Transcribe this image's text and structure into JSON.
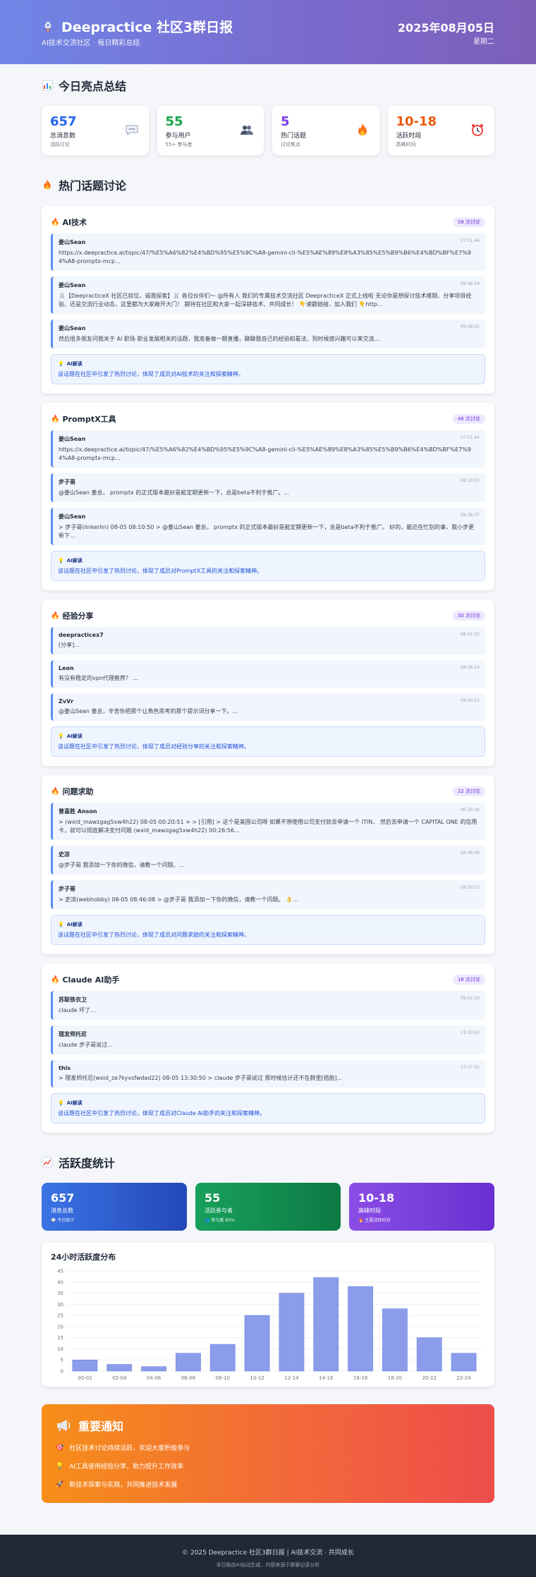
{
  "header": {
    "title": "Deepractice 社区3群日报",
    "subtitle": "AI技术交流社区 · 每日精彩总结",
    "date": "2025年08月05日",
    "weekday": "星期二"
  },
  "summary": {
    "title": "今日亮点总结",
    "cards": [
      {
        "value": "657",
        "label": "总消息数",
        "sub": "活跃讨论",
        "color": "#2563eb",
        "icon": "speech-bubble-icon"
      },
      {
        "value": "55",
        "label": "参与用户",
        "sub": "55+ 参与者",
        "color": "#16a34a",
        "icon": "users-icon"
      },
      {
        "value": "5",
        "label": "热门话题",
        "sub": "讨论焦点",
        "color": "#7c3aed",
        "icon": "fire-icon"
      },
      {
        "value": "10-18",
        "label": "活跃时段",
        "sub": "高峰时间",
        "color": "#ea580c",
        "icon": "alarm-clock-icon"
      }
    ]
  },
  "topics": {
    "title": "热门话题讨论",
    "ai_label": "AI解读",
    "items": [
      {
        "name": "AI技术",
        "badge": "58 次讨论",
        "messages": [
          {
            "author": "姜山Sean",
            "time": "07:51:44",
            "text": "https://x.deepractice.ai/topic/47/%E5%A6%82%E4%BD%95%E5%9C%A8-gemini-cli-%E5%AE%89%E8%A3%85%E5%B9%B6%E4%BD%BF%E7%94%A8-promptx-mcp..."
          },
          {
            "author": "姜山Sean",
            "time": "09:46:59",
            "text": "🐰【DeepracticeX 社区已就位，诚邀探索】🐰 各位伙伴们～ @所有人 我们的专属技术交流社区 DeepracticeX 正式上线啦 无论你是想探讨技术难题、分享项目经验、还是交流行业动态，这里都为大家敞开大门！ 期待在社区和大家一起深耕技术、共同成长！ 👇速戳链接，加入我们 👇http..."
          },
          {
            "author": "姜山Sean",
            "time": "09:58:01",
            "text": "然后很多朋友问我关于 AI 职场 职业发展相关的话题，我准备做一期直播，聊聊我自己的经验和看法，到时候感兴趣可以来交流..."
          }
        ],
        "ai": "该话题在社区中引发了热烈讨论，体现了成员对AI技术的关注和探索精神。"
      },
      {
        "name": "PromptX工具",
        "badge": "46 次讨论",
        "messages": [
          {
            "author": "姜山Sean",
            "time": "07:51:44",
            "text": "https://x.deepractice.ai/topic/47/%E5%A6%82%E4%BD%95%E5%9C%A8-gemini-cli-%E5%AE%89%E8%A3%85%E5%B9%B6%E4%BD%BF%E7%94%A8-promptx-mcp..."
          },
          {
            "author": "步子哥",
            "time": "08:10:50",
            "text": "@姜山Sean 姜总， promptx 的正式版本最好是能定期更新一下，总是beta不利于推广。..."
          },
          {
            "author": "姜山Sean",
            "time": "09:36:37",
            "text": "> 步子哥(linkerlin) 08-05 08:10:50 > @姜山Sean 姜总， promptx 的正式版本最好是能定期更新一下，总是beta不利于推广。 好的，最近在忙别的事，我小步更新下..."
          }
        ],
        "ai": "该话题在社区中引发了热烈讨论，体现了成员对PromptX工具的关注和探索精神。"
      },
      {
        "name": "经验分享",
        "badge": "30 次讨论",
        "messages": [
          {
            "author": "deepracticex7",
            "time": "08:01:25",
            "text": "[分享]..."
          },
          {
            "author": "Leon",
            "time": "09:26:24",
            "text": "有没有稳定的vpn代理推荐？ ..."
          },
          {
            "author": "ZvVr",
            "time": "09:43:23",
            "text": "@姜山Sean 姜总，辛苦你把那个让角色思考的那个提示词分享一下。..."
          }
        ],
        "ai": "该话题在社区中引发了热烈讨论，体现了成员对经验分享的关注和探索精神。"
      },
      {
        "name": "问题求助",
        "badge": "22 次讨论",
        "messages": [
          {
            "author": "曾喜胜 Anson",
            "time": "00:20:34",
            "text": "> (wxid_mawzgag5xw4h22) 08-05 00:20:51 > > [引用] > 这个是美国公司呀 如果不想使用公司支付就去申请一个 ITIN， 然后去申请一个 CAPITAL ONE 的信用卡，就可以彻底解决支付问题 (wxid_mawzgag5xw4h22) 00:26:56..."
          },
          {
            "author": "史凉",
            "time": "08:46:08",
            "text": "@步子哥 我添加一下你的微信，请教一个问题。..."
          },
          {
            "author": "步子哥",
            "time": "08:50:53",
            "text": "> 史凉(webhobby) 08-05 08:46:08 > @步子哥 我添加一下你的微信，请教一个问题。 👌..."
          }
        ],
        "ai": "该话题在社区中引发了热烈讨论，体现了成员对问题求助的关注和探索精神。"
      },
      {
        "name": "Claude AI助手",
        "badge": "16 次讨论",
        "messages": [
          {
            "author": "苏联铁衣卫",
            "time": "09:52:20",
            "text": "claude 坏了..."
          },
          {
            "author": "理发师托尼",
            "time": "13:30:50",
            "text": "claude 步子哥说过..."
          },
          {
            "author": "this",
            "time": "13:37:31",
            "text": "> 理发师托尼(wxid_ze7kyvsfwdad22) 08-05 13:30:50 > claude 步子哥说过 那时候估计还不在群里[捂脸]..."
          }
        ],
        "ai": "该话题在社区中引发了热烈讨论，体现了成员对Claude AI助手的关注和探索精神。"
      }
    ]
  },
  "activity": {
    "title": "活跃度统计",
    "cards": [
      {
        "value": "657",
        "label": "消息总数",
        "sub": "💬 今日统计",
        "from": "#3b73e4",
        "to": "#2348b8"
      },
      {
        "value": "55",
        "label": "活跃参与者",
        "sub": "👥 参与度 85%",
        "from": "#18a05c",
        "to": "#0d7a45"
      },
      {
        "value": "10-18",
        "label": "高峰时段",
        "sub": "🔥 主要活跃时间",
        "from": "#8a4ee6",
        "to": "#6b2fd1"
      }
    ]
  },
  "chart_data": {
    "type": "bar",
    "title": "24小时活跃度分布",
    "categories": [
      "00-02",
      "02-04",
      "04-06",
      "06-08",
      "08-10",
      "10-12",
      "12-14",
      "14-16",
      "16-18",
      "18-20",
      "20-22",
      "22-24"
    ],
    "values": [
      5,
      3,
      2,
      8,
      12,
      25,
      35,
      42,
      38,
      28,
      15,
      8
    ],
    "ylim": [
      0,
      45
    ],
    "yticks": [
      0,
      5,
      10,
      15,
      20,
      25,
      30,
      35,
      40,
      45
    ],
    "grid": true,
    "bar_color": "#8b9dea"
  },
  "notice": {
    "title": "重要通知",
    "items": [
      {
        "icon": "target-icon",
        "text": "社区技术讨论持续活跃，欢迎大家积极参与"
      },
      {
        "icon": "lightbulb-icon",
        "text": "AI工具使用经验分享，助力提升工作效率"
      },
      {
        "icon": "rocket-icon",
        "text": "新技术探索与实践，共同推进技术发展"
      }
    ]
  },
  "footer": {
    "line1": "© 2025 Deepractice 社区3群日报 | AI技术交流 · 共同成长",
    "line2": "本日报由AI自动生成，内容来源于群聊记录分析"
  }
}
